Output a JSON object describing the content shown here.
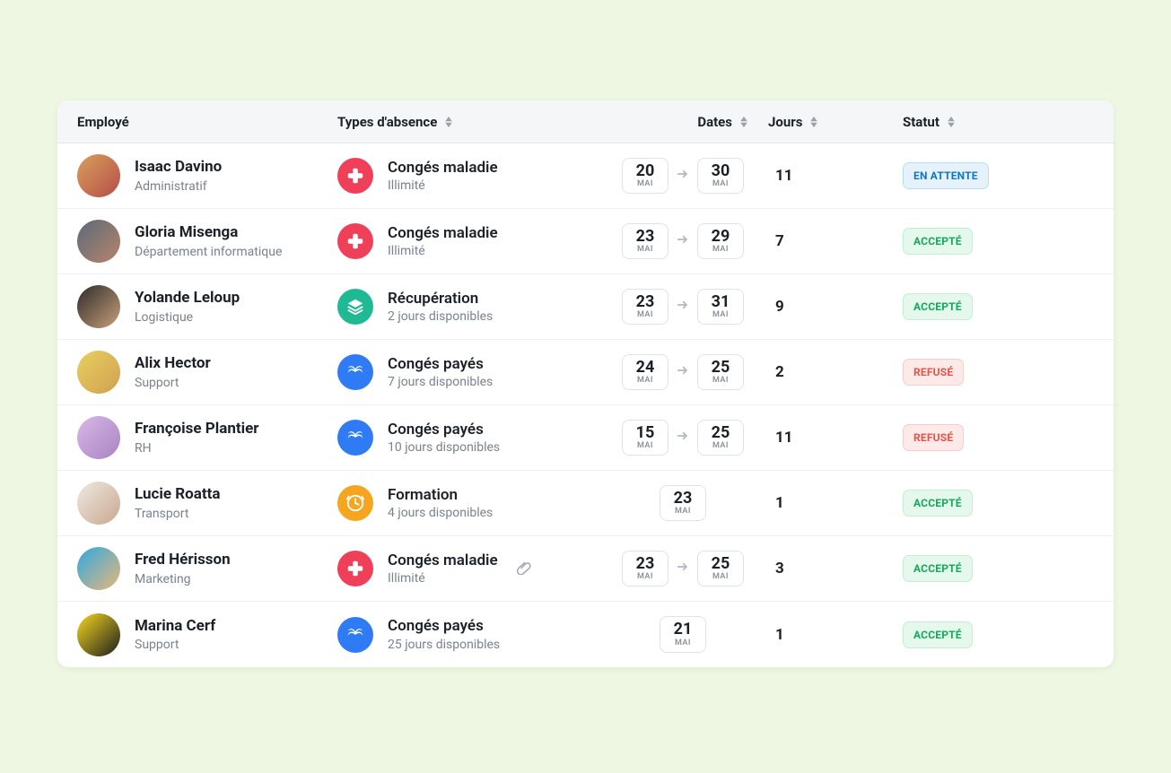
{
  "columns": {
    "employee": "Employé",
    "absence_type": "Types d'absence",
    "dates": "Dates",
    "days": "Jours",
    "status": "Statut"
  },
  "month_abbrev": "MAI",
  "status_labels": {
    "pending": "EN ATTENTE",
    "accepted": "ACCEPTÉ",
    "refused": "REFUSÉ"
  },
  "absence_types": {
    "sick": {
      "label": "Congés maladie",
      "sub": "Illimité",
      "color": "#ef3f59",
      "icon": "medical-cross-icon"
    },
    "recovery": {
      "label": "Récupération",
      "sub": "2 jours disponibles",
      "color": "#1fb993",
      "icon": "layers-icon"
    },
    "paid7": {
      "label": "Congés payés",
      "sub": "7 jours disponibles",
      "color": "#2f7bf6",
      "icon": "palm-icon"
    },
    "paid10": {
      "label": "Congés payés",
      "sub": "10 jours disponibles",
      "color": "#2f7bf6",
      "icon": "palm-icon"
    },
    "paid25": {
      "label": "Congés payés",
      "sub": "25 jours disponibles",
      "color": "#2f7bf6",
      "icon": "palm-icon"
    },
    "training": {
      "label": "Formation",
      "sub": "4 jours disponibles",
      "color": "#f6a51f",
      "icon": "clock-icon"
    }
  },
  "rows": [
    {
      "name": "Isaac Davino",
      "dept": "Administratif",
      "type": "sick",
      "start": "20",
      "end": "30",
      "days": "11",
      "status": "pending",
      "attachment": false,
      "avatar_colors": [
        "#d8a05c",
        "#b64d49"
      ]
    },
    {
      "name": "Gloria Misenga",
      "dept": "Département informatique",
      "type": "sick",
      "start": "23",
      "end": "29",
      "days": "7",
      "status": "accepted",
      "attachment": false,
      "avatar_colors": [
        "#5b6a7a",
        "#b8846a"
      ]
    },
    {
      "name": "Yolande Leloup",
      "dept": "Logistique",
      "type": "recovery",
      "start": "23",
      "end": "31",
      "days": "9",
      "status": "accepted",
      "attachment": false,
      "avatar_colors": [
        "#2f2a2a",
        "#c8a07a"
      ]
    },
    {
      "name": "Alix Hector",
      "dept": "Support",
      "type": "paid7",
      "start": "24",
      "end": "25",
      "days": "2",
      "status": "refused",
      "attachment": false,
      "avatar_colors": [
        "#e8d060",
        "#d0a050"
      ]
    },
    {
      "name": "Françoise Plantier",
      "dept": "RH",
      "type": "paid10",
      "start": "15",
      "end": "25",
      "days": "11",
      "status": "refused",
      "attachment": false,
      "avatar_colors": [
        "#d8b8e8",
        "#a884c0"
      ]
    },
    {
      "name": "Lucie Roatta",
      "dept": "Transport",
      "type": "training",
      "start": "23",
      "end": null,
      "days": "1",
      "status": "accepted",
      "attachment": false,
      "avatar_colors": [
        "#f0e8e0",
        "#c8a890"
      ]
    },
    {
      "name": "Fred Hérisson",
      "dept": "Marketing",
      "type": "sick",
      "start": "23",
      "end": "25",
      "days": "3",
      "status": "accepted",
      "attachment": true,
      "avatar_colors": [
        "#2fa8e0",
        "#e8b878"
      ]
    },
    {
      "name": "Marina Cerf",
      "dept": "Support",
      "type": "paid25",
      "start": "21",
      "end": null,
      "days": "1",
      "status": "accepted",
      "attachment": false,
      "avatar_colors": [
        "#f6d820",
        "#1c1c1c"
      ]
    }
  ]
}
